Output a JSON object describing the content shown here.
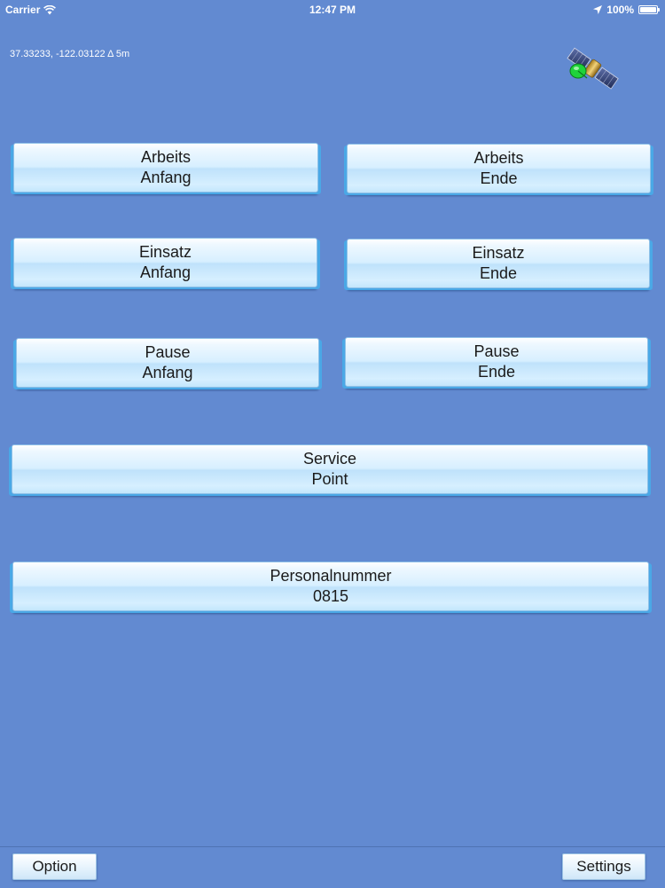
{
  "status_bar": {
    "carrier": "Carrier",
    "time": "12:47 PM",
    "battery": "100%",
    "battery_level": 1.0
  },
  "gps": {
    "readout": "37.33233, -122.03122   Δ 5m"
  },
  "icons": {
    "wifi": "wifi-icon",
    "location": "location-arrow-icon",
    "battery": "battery-icon",
    "satellite": "satellite-icon"
  },
  "buttons": {
    "work_start": {
      "line1": "Arbeits",
      "line2": "Anfang"
    },
    "work_end": {
      "line1": "Arbeits",
      "line2": "Ende"
    },
    "assignment_start": {
      "line1": "Einsatz",
      "line2": "Anfang"
    },
    "assignment_end": {
      "line1": "Einsatz",
      "line2": "Ende"
    },
    "break_start": {
      "line1": "Pause",
      "line2": "Anfang"
    },
    "break_end": {
      "line1": "Pause",
      "line2": "Ende"
    },
    "service_point": {
      "line1": "Service",
      "line2": "Point"
    },
    "personnel_number": {
      "line1": "Personalnummer",
      "line2": "0815"
    }
  },
  "toolbar": {
    "option_label": "Option",
    "settings_label": "Settings"
  },
  "colors": {
    "background": "#628ad1",
    "button_edge": "#4aa8e6"
  }
}
